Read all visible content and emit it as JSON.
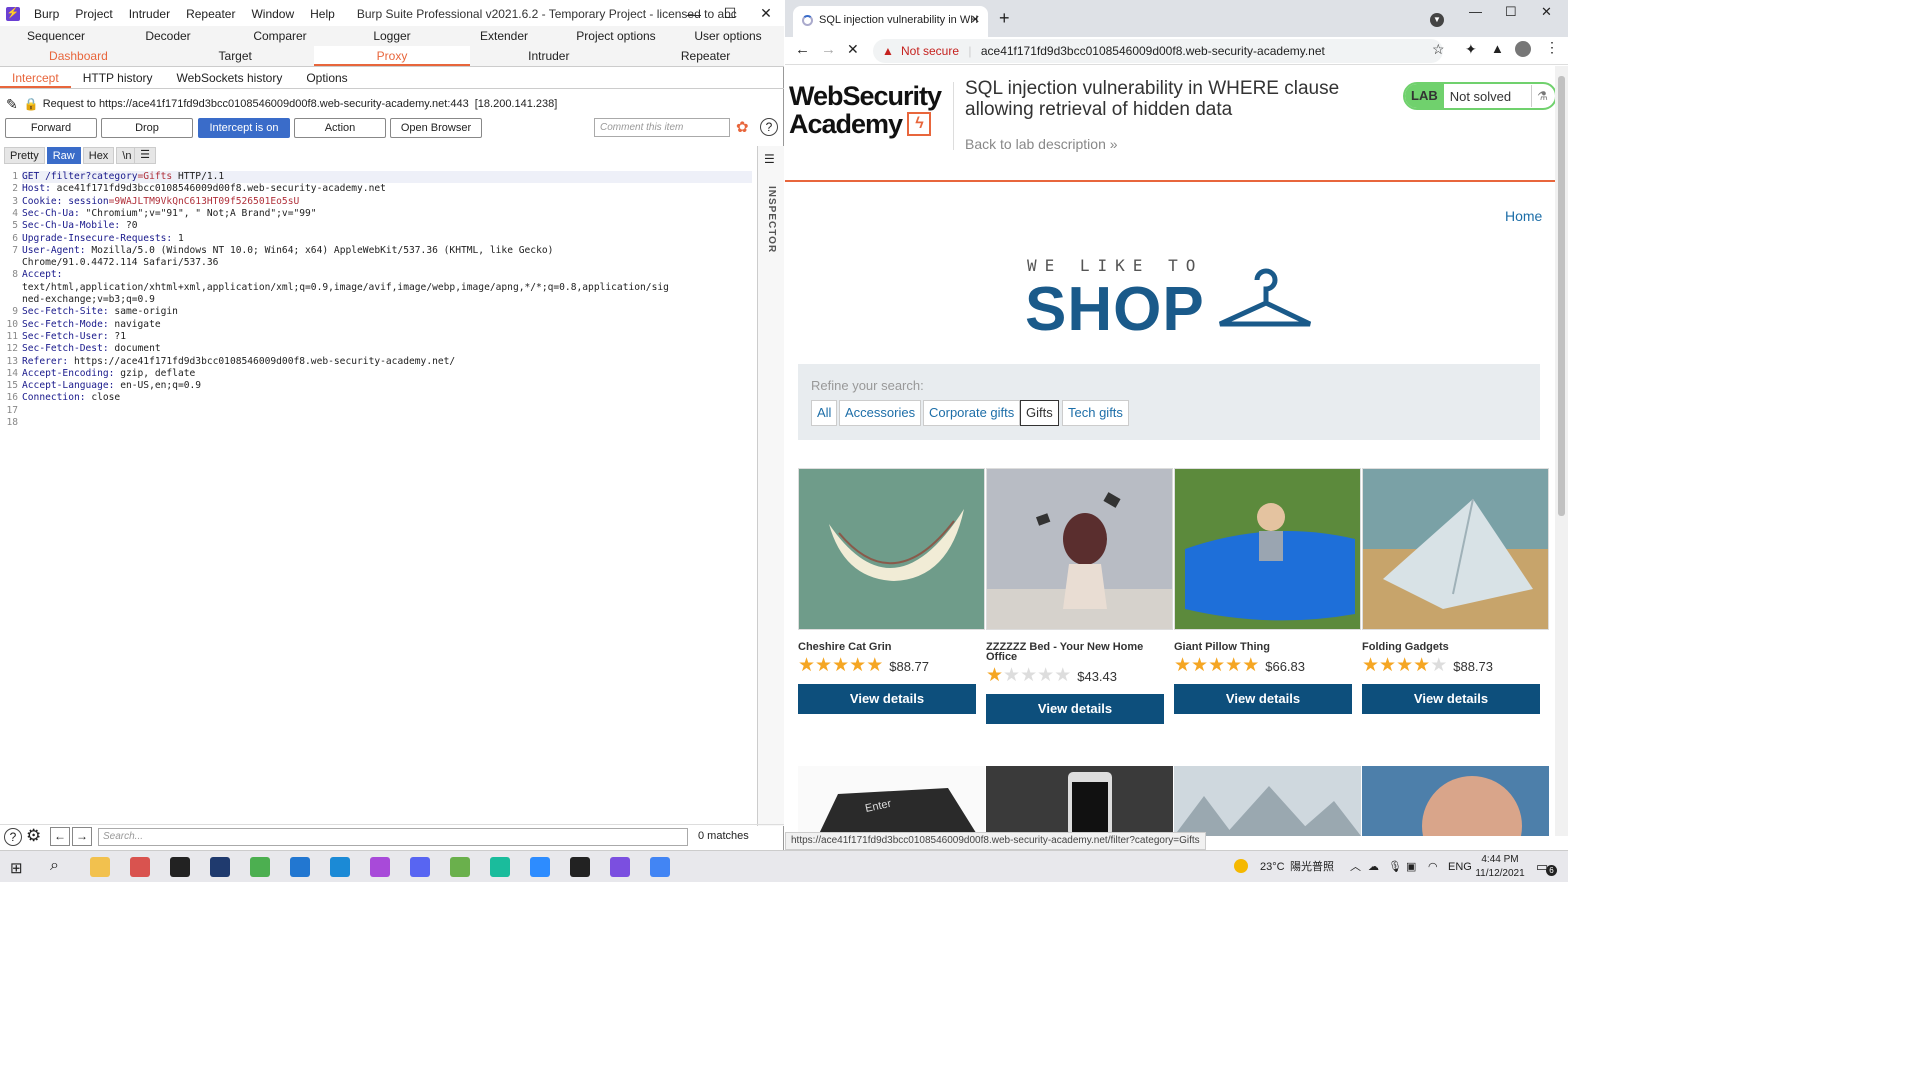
{
  "burp": {
    "title_menu": [
      "Burp",
      "Project",
      "Intruder",
      "Repeater",
      "Window",
      "Help"
    ],
    "window_title": "Burp Suite Professional v2021.6.2 - Temporary Project - licensed to abc",
    "tabs_row1": [
      "Sequencer",
      "Decoder",
      "Comparer",
      "Logger",
      "Extender",
      "Project options",
      "User options"
    ],
    "tabs_row2": [
      "Dashboard",
      "Target",
      "Proxy",
      "Intruder",
      "Repeater"
    ],
    "subtabs": [
      "Intercept",
      "HTTP history",
      "WebSockets history",
      "Options"
    ],
    "request_label": "Request to https://ace41f171fd9d3bcc0108546009d00f8.web-security-academy.net:443",
    "request_ip": "[18.200.141.238]",
    "buttons": {
      "forward": "Forward",
      "drop": "Drop",
      "intercept": "Intercept is on",
      "action": "Action",
      "open_browser": "Open Browser"
    },
    "comment_placeholder": "Comment this item",
    "format_tabs": [
      "Pretty",
      "Raw",
      "Hex",
      "\\n"
    ],
    "inspector_label": "INSPECTOR",
    "search_placeholder": "Search...",
    "matches": "0 matches",
    "request_lines": [
      {
        "n": "1",
        "h": "GET /filter?",
        "hk": "category",
        "hv": "=Gifts",
        "rest": " HTTP/1.1"
      },
      {
        "n": "2",
        "h": "Host:",
        "rest": " ace41f171fd9d3bcc0108546009d00f8.web-security-academy.net"
      },
      {
        "n": "3",
        "h": "Cookie:",
        "hk": " session",
        "hv": "=9WAJLTM9VkQnC613HT09f526501Eo5sU",
        "rest": ""
      },
      {
        "n": "4",
        "h": "Sec-Ch-Ua:",
        "rest": " \"Chromium\";v=\"91\", \" Not;A Brand\";v=\"99\""
      },
      {
        "n": "5",
        "h": "Sec-Ch-Ua-Mobile:",
        "rest": " ?0"
      },
      {
        "n": "6",
        "h": "Upgrade-Insecure-Requests:",
        "rest": " 1"
      },
      {
        "n": "7",
        "h": "User-Agent:",
        "rest": " Mozilla/5.0 (Windows NT 10.0; Win64; x64) AppleWebKit/537.36 (KHTML, like Gecko)"
      },
      {
        "n": "",
        "h": "",
        "rest": "Chrome/91.0.4472.114 Safari/537.36"
      },
      {
        "n": "8",
        "h": "Accept:",
        "rest": ""
      },
      {
        "n": "",
        "h": "",
        "rest": "text/html,application/xhtml+xml,application/xml;q=0.9,image/avif,image/webp,image/apng,*/*;q=0.8,application/sig"
      },
      {
        "n": "",
        "h": "",
        "rest": "ned-exchange;v=b3;q=0.9"
      },
      {
        "n": "9",
        "h": "Sec-Fetch-Site:",
        "rest": " same-origin"
      },
      {
        "n": "10",
        "h": "Sec-Fetch-Mode:",
        "rest": " navigate"
      },
      {
        "n": "11",
        "h": "Sec-Fetch-User:",
        "rest": " ?1"
      },
      {
        "n": "12",
        "h": "Sec-Fetch-Dest:",
        "rest": " document"
      },
      {
        "n": "13",
        "h": "Referer:",
        "rest": " https://ace41f171fd9d3bcc0108546009d00f8.web-security-academy.net/"
      },
      {
        "n": "14",
        "h": "Accept-Encoding:",
        "rest": " gzip, deflate"
      },
      {
        "n": "15",
        "h": "Accept-Language:",
        "rest": " en-US,en;q=0.9"
      },
      {
        "n": "16",
        "h": "Connection:",
        "rest": " close"
      },
      {
        "n": "17",
        "h": "",
        "rest": ""
      },
      {
        "n": "18",
        "h": "",
        "rest": ""
      }
    ]
  },
  "browser": {
    "tab_title": "SQL injection vulnerability in WH",
    "not_secure": "Not secure",
    "url": "ace41f171fd9d3bcc0108546009d00f8.web-security-academy.net",
    "status_url": "https://ace41f171fd9d3bcc0108546009d00f8.web-security-academy.net/filter?category=Gifts"
  },
  "page": {
    "logo_line1": "WebSecurity",
    "logo_line2": "Academy",
    "lab_title": "SQL injection vulnerability in WHERE clause allowing retrieval of hidden data",
    "back": "Back to lab description",
    "lab_badge": "LAB",
    "lab_status": "Not solved",
    "home": "Home",
    "shop_small": "WE LIKE TO",
    "shop_big": "SHOP",
    "refine_label": "Refine your search:",
    "categories": [
      "All",
      "Accessories",
      "Corporate gifts",
      "Gifts",
      "Tech gifts"
    ],
    "active_category": "Gifts",
    "view_details": "View details",
    "products": [
      {
        "name": "Cheshire Cat Grin",
        "price": "$88.77",
        "rating": 5
      },
      {
        "name": "ZZZZZZ Bed - Your New Home Office",
        "price": "$43.43",
        "rating": 1
      },
      {
        "name": "Giant Pillow Thing",
        "price": "$66.83",
        "rating": 5
      },
      {
        "name": "Folding Gadgets",
        "price": "$88.73",
        "rating": 4
      }
    ]
  },
  "taskbar": {
    "weather": "23°C",
    "weather_desc": "陽光普照",
    "lang": "ENG",
    "time": "4:44 PM",
    "date": "11/12/2021",
    "notif_count": "6"
  },
  "colors": {
    "accent": "#e8663c",
    "burp_blue": "#3a6cc9",
    "wsa_blue": "#0d4f7c",
    "lab_green": "#70d16d",
    "star": "#f5a623"
  }
}
